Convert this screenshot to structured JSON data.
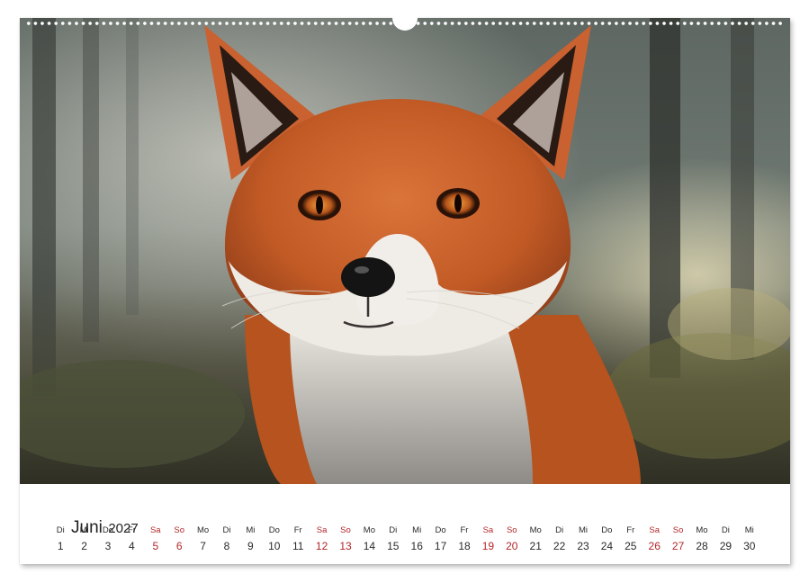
{
  "calendar": {
    "month": "Juni",
    "year": "2027",
    "accent_color": "#b3262a",
    "days": [
      {
        "name": "Di",
        "num": "1"
      },
      {
        "name": "Mi",
        "num": "2"
      },
      {
        "name": "Do",
        "num": "3"
      },
      {
        "name": "Fr",
        "num": "4"
      },
      {
        "name": "Sa",
        "num": "5"
      },
      {
        "name": "So",
        "num": "6"
      },
      {
        "name": "Mo",
        "num": "7"
      },
      {
        "name": "Di",
        "num": "8"
      },
      {
        "name": "Mi",
        "num": "9"
      },
      {
        "name": "Do",
        "num": "10"
      },
      {
        "name": "Fr",
        "num": "11"
      },
      {
        "name": "Sa",
        "num": "12"
      },
      {
        "name": "So",
        "num": "13"
      },
      {
        "name": "Mo",
        "num": "14"
      },
      {
        "name": "Di",
        "num": "15"
      },
      {
        "name": "Mi",
        "num": "16"
      },
      {
        "name": "Do",
        "num": "17"
      },
      {
        "name": "Fr",
        "num": "18"
      },
      {
        "name": "Sa",
        "num": "19"
      },
      {
        "name": "So",
        "num": "20"
      },
      {
        "name": "Mo",
        "num": "21"
      },
      {
        "name": "Di",
        "num": "22"
      },
      {
        "name": "Mi",
        "num": "23"
      },
      {
        "name": "Do",
        "num": "24"
      },
      {
        "name": "Fr",
        "num": "25"
      },
      {
        "name": "Sa",
        "num": "26"
      },
      {
        "name": "So",
        "num": "27"
      },
      {
        "name": "Mo",
        "num": "28"
      },
      {
        "name": "Di",
        "num": "29"
      },
      {
        "name": "Mi",
        "num": "30"
      }
    ]
  }
}
